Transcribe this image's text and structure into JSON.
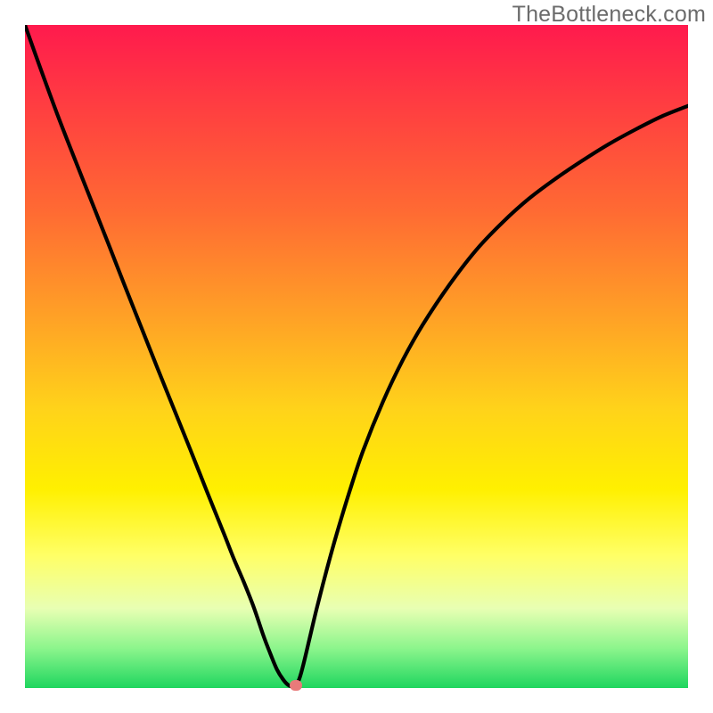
{
  "watermark": "TheBottleneck.com",
  "colors": {
    "watermark": "#6b6b6b",
    "curve": "#000000",
    "marker": "#e87a7a",
    "gradient_stops": [
      "#ff1a4d",
      "#ff4040",
      "#ff6a33",
      "#ffa126",
      "#ffd31a",
      "#fff000",
      "#ffff66",
      "#e8ffb3",
      "#8cf58c",
      "#1fd65f"
    ]
  },
  "chart_data": {
    "type": "line",
    "title": "",
    "xlabel": "",
    "ylabel": "",
    "xlim": [
      0,
      1
    ],
    "ylim": [
      0,
      1
    ],
    "x": [
      0.0,
      0.025,
      0.05,
      0.075,
      0.1,
      0.125,
      0.15,
      0.175,
      0.2,
      0.225,
      0.25,
      0.275,
      0.3,
      0.315,
      0.33,
      0.345,
      0.36,
      0.37,
      0.38,
      0.39,
      0.398,
      0.405,
      0.413,
      0.42,
      0.43,
      0.44,
      0.455,
      0.47,
      0.49,
      0.51,
      0.54,
      0.57,
      0.6,
      0.64,
      0.68,
      0.72,
      0.76,
      0.8,
      0.84,
      0.88,
      0.92,
      0.96,
      1.0
    ],
    "values": [
      1.0,
      0.93,
      0.862,
      0.798,
      0.735,
      0.672,
      0.608,
      0.545,
      0.482,
      0.42,
      0.358,
      0.295,
      0.233,
      0.195,
      0.16,
      0.122,
      0.078,
      0.052,
      0.028,
      0.012,
      0.004,
      0.003,
      0.012,
      0.036,
      0.078,
      0.12,
      0.178,
      0.232,
      0.298,
      0.358,
      0.432,
      0.495,
      0.548,
      0.608,
      0.66,
      0.702,
      0.738,
      0.768,
      0.795,
      0.82,
      0.842,
      0.862,
      0.878
    ],
    "marker": {
      "x": 0.408,
      "y": 0.004
    },
    "grid": false,
    "legend": false
  }
}
